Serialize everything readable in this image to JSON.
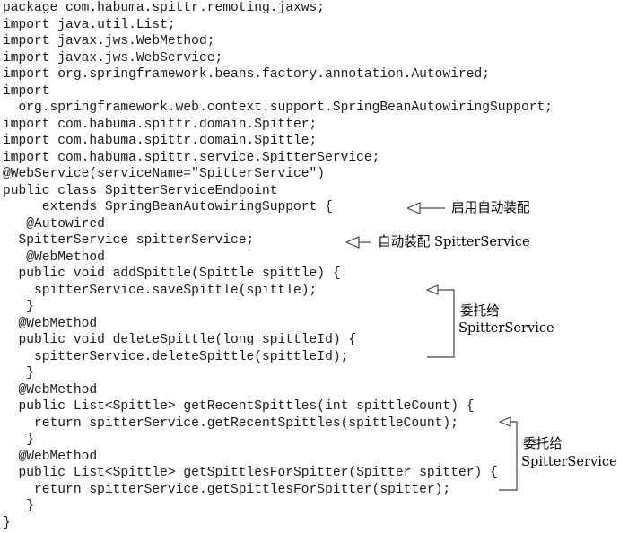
{
  "code_lines": [
    "package com.habuma.spittr.remoting.jaxws;",
    "import java.util.List;",
    "import javax.jws.WebMethod;",
    "import javax.jws.WebService;",
    "import org.springframework.beans.factory.annotation.Autowired;",
    "import",
    "  org.springframework.web.context.support.SpringBeanAutowiringSupport;",
    "import com.habuma.spittr.domain.Spitter;",
    "import com.habuma.spittr.domain.Spittle;",
    "import com.habuma.spittr.service.SpitterService;",
    "@WebService(serviceName=\"SpitterService\")",
    "public class SpitterServiceEndpoint",
    "     extends SpringBeanAutowiringSupport {",
    "   @Autowired",
    "  SpitterService spitterService;",
    "   @WebMethod",
    "  public void addSpittle(Spittle spittle) {",
    "    spitterService.saveSpittle(spittle);",
    "   }",
    "  @WebMethod",
    "  public void deleteSpittle(long spittleId) {",
    "    spitterService.deleteSpittle(spittleId);",
    "   }",
    "  @WebMethod",
    "  public List<Spittle> getRecentSpittles(int spittleCount) {",
    "    return spitterService.getRecentSpittles(spittleCount);",
    "   }",
    "  @WebMethod",
    "  public List<Spittle> getSpittlesForSpitter(Spitter spitter) {",
    "    return spitterService.getSpittlesForSpitter(spitter);",
    "   }",
    "}"
  ],
  "annotations": {
    "autowiring_support": "启用自动装配",
    "autowire_service": "自动装配 SpitterService",
    "delegate_1_line1": "委托给",
    "delegate_1_line2": "SpitterService",
    "delegate_2_line1": "委托给",
    "delegate_2_line2": "SpitterService"
  }
}
